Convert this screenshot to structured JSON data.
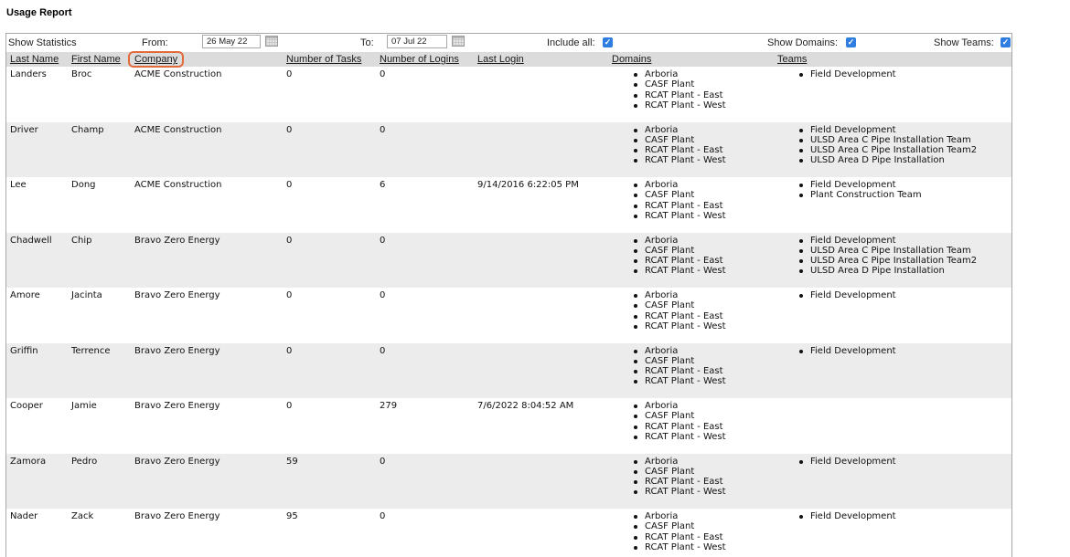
{
  "title": "Usage Report",
  "filters": {
    "show_statistics": "Show Statistics",
    "from_label": "From:",
    "from_value": "26 May 22",
    "to_label": "To:",
    "to_value": "07 Jul 22",
    "include_all_label": "Include all:",
    "show_domains_label": "Show Domains:",
    "show_teams_label": "Show Teams:",
    "checkmark": "✓"
  },
  "columns": {
    "last_name": "Last Name",
    "first_name": "First Name",
    "company": "Company",
    "tasks": "Number of Tasks",
    "logins": "Number of Logins",
    "last_login": "Last Login",
    "domains": "Domains",
    "teams": "Teams"
  },
  "rows": [
    {
      "last": "Landers",
      "first": "Broc",
      "company": "ACME Construction",
      "tasks": "0",
      "logins": "0",
      "last_login": "",
      "domains": [
        "Arboria",
        "CASF Plant",
        "RCAT Plant - East",
        "RCAT Plant - West"
      ],
      "teams": [
        "Field Development"
      ]
    },
    {
      "last": "Driver",
      "first": "Champ",
      "company": "ACME Construction",
      "tasks": "0",
      "logins": "0",
      "last_login": "",
      "domains": [
        "Arboria",
        "CASF Plant",
        "RCAT Plant - East",
        "RCAT Plant - West"
      ],
      "teams": [
        "Field Development",
        "ULSD Area C Pipe Installation Team",
        "ULSD Area C Pipe Installation Team2",
        "ULSD Area D Pipe Installation"
      ]
    },
    {
      "last": "Lee",
      "first": "Dong",
      "company": "ACME Construction",
      "tasks": "0",
      "logins": "6",
      "last_login": "9/14/2016 6:22:05 PM",
      "domains": [
        "Arboria",
        "CASF Plant",
        "RCAT Plant - East",
        "RCAT Plant - West"
      ],
      "teams": [
        "Field Development",
        "Plant Construction Team"
      ]
    },
    {
      "last": "Chadwell",
      "first": "Chip",
      "company": "Bravo Zero Energy",
      "tasks": "0",
      "logins": "0",
      "last_login": "",
      "domains": [
        "Arboria",
        "CASF Plant",
        "RCAT Plant - East",
        "RCAT Plant - West"
      ],
      "teams": [
        "Field Development",
        "ULSD Area C Pipe Installation Team",
        "ULSD Area C Pipe Installation Team2",
        "ULSD Area D Pipe Installation"
      ]
    },
    {
      "last": "Amore",
      "first": "Jacinta",
      "company": "Bravo Zero Energy",
      "tasks": "0",
      "logins": "0",
      "last_login": "",
      "domains": [
        "Arboria",
        "CASF Plant",
        "RCAT Plant - East",
        "RCAT Plant - West"
      ],
      "teams": [
        "Field Development"
      ]
    },
    {
      "last": "Griffin",
      "first": "Terrence",
      "company": "Bravo Zero Energy",
      "tasks": "0",
      "logins": "0",
      "last_login": "",
      "domains": [
        "Arboria",
        "CASF Plant",
        "RCAT Plant - East",
        "RCAT Plant - West"
      ],
      "teams": [
        "Field Development"
      ]
    },
    {
      "last": "Cooper",
      "first": "Jamie",
      "company": "Bravo Zero Energy",
      "tasks": "0",
      "logins": "279",
      "last_login": "7/6/2022 8:04:52 AM",
      "domains": [
        "Arboria",
        "CASF Plant",
        "RCAT Plant - East",
        "RCAT Plant - West"
      ],
      "teams": []
    },
    {
      "last": "Zamora",
      "first": "Pedro",
      "company": "Bravo Zero Energy",
      "tasks": "59",
      "logins": "0",
      "last_login": "",
      "domains": [
        "Arboria",
        "CASF Plant",
        "RCAT Plant - East",
        "RCAT Plant - West"
      ],
      "teams": [
        "Field Development"
      ]
    },
    {
      "last": "Nader",
      "first": "Zack",
      "company": "Bravo Zero Energy",
      "tasks": "95",
      "logins": "0",
      "last_login": "",
      "domains": [
        "Arboria",
        "CASF Plant",
        "RCAT Plant - East",
        "RCAT Plant - West"
      ],
      "teams": [
        "Field Development"
      ]
    }
  ]
}
